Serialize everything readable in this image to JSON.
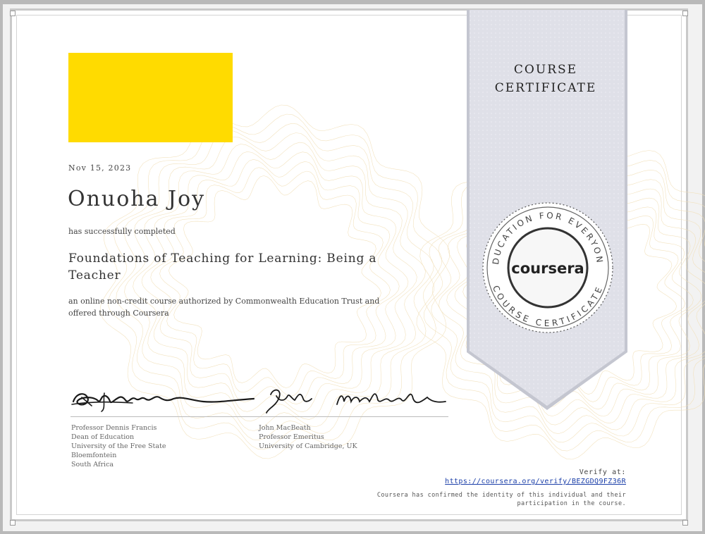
{
  "certificate": {
    "date": "Nov 15, 2023",
    "recipient": "Onuoha Joy",
    "completed_text": "has successfully completed",
    "course_title": "Foundations of Teaching for Learning: Being a Teacher",
    "description": "an online non-credit course authorized by Commonwealth Education Trust and offered through Coursera"
  },
  "logo": {
    "color": "#ffdb00"
  },
  "ribbon": {
    "title_line1": "COURSE",
    "title_line2": "CERTIFICATE",
    "seal_top_text": "EDUCATION FOR EVERYONE",
    "seal_bottom_text": "COURSE CERTIFICATE",
    "seal_brand": "coursera"
  },
  "signatories": [
    {
      "name": "Professor Dennis Francis",
      "role": "Dean of Education",
      "org": "University of the Free State",
      "city": "Bloemfontein",
      "country": "South Africa"
    },
    {
      "name": "John MacBeath",
      "role": "Professor Emeritus",
      "org": "University of Cambridge, UK"
    }
  ],
  "verify": {
    "label": "Verify at:",
    "url": "https://coursera.org/verify/BEZGDQ9FZ36R",
    "note_line1": "Coursera has confirmed the identity of this individual and their",
    "note_line2": "participation in the course."
  }
}
